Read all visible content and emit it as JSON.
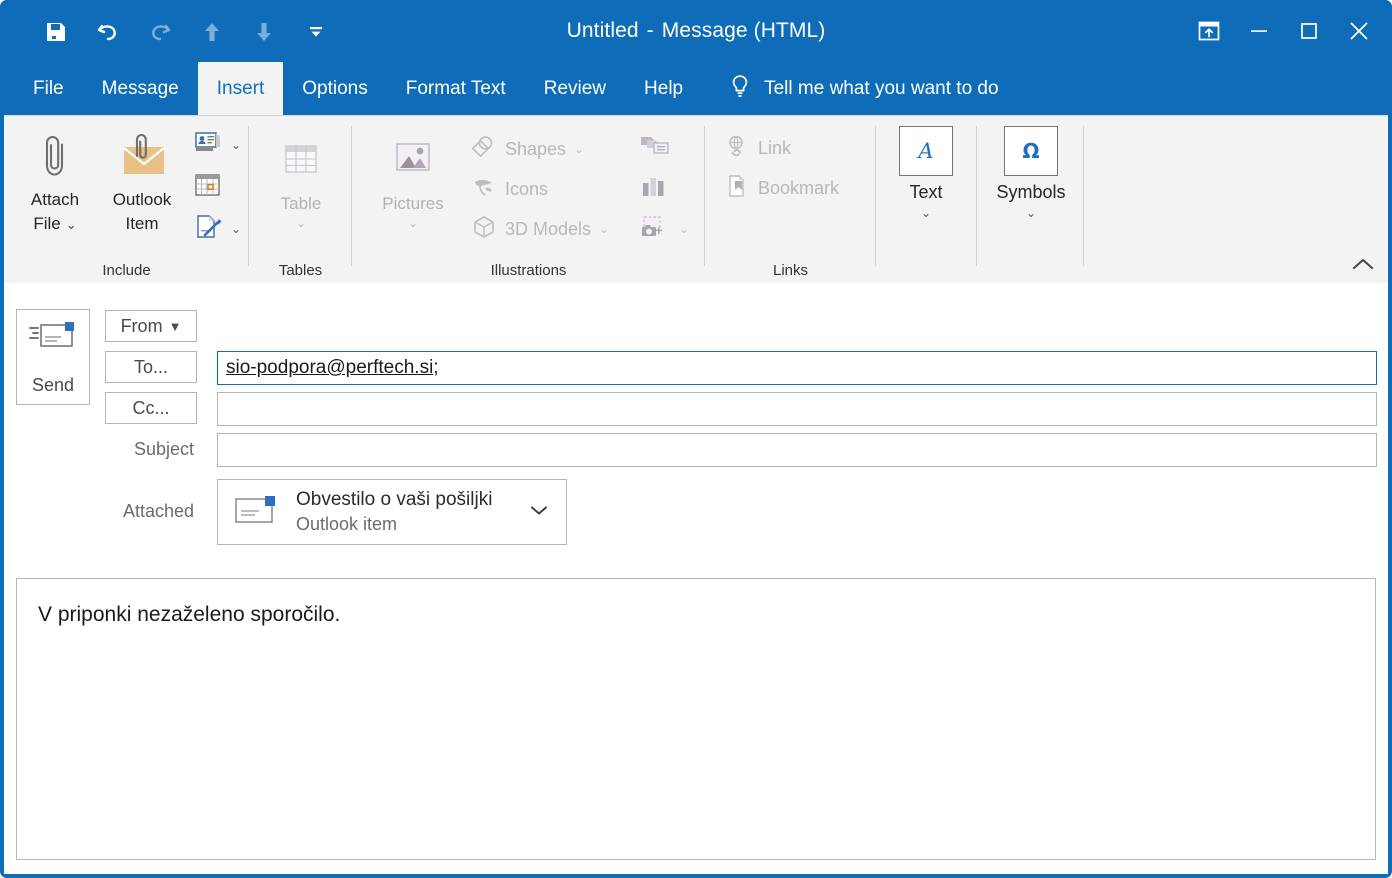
{
  "window": {
    "title_main": "Untitled",
    "title_sep": "-",
    "title_rest": "Message (HTML)",
    "accent_color": "#0f6cb8",
    "ribbon_bg": "#f3f3f3"
  },
  "quick_access": [
    {
      "name": "save-icon",
      "label": "Save",
      "enabled": true
    },
    {
      "name": "undo-icon",
      "label": "Undo",
      "enabled": true
    },
    {
      "name": "redo-icon",
      "label": "Redo",
      "enabled": false
    },
    {
      "name": "previous-item-icon",
      "label": "Previous Item",
      "enabled": false
    },
    {
      "name": "next-item-icon",
      "label": "Next Item",
      "enabled": false
    },
    {
      "name": "customize-quick-access-toolbar-icon",
      "label": "Customize Quick Access Toolbar",
      "enabled": true
    }
  ],
  "window_controls": [
    {
      "name": "ribbon-display-options-icon",
      "label": "Ribbon Display Options"
    },
    {
      "name": "minimize-icon",
      "label": "Minimize"
    },
    {
      "name": "maximize-icon",
      "label": "Maximize"
    },
    {
      "name": "close-icon",
      "label": "Close"
    }
  ],
  "tabs": [
    {
      "label": "File",
      "active": false
    },
    {
      "label": "Message",
      "active": false
    },
    {
      "label": "Insert",
      "active": true
    },
    {
      "label": "Options",
      "active": false
    },
    {
      "label": "Format Text",
      "active": false
    },
    {
      "label": "Review",
      "active": false
    },
    {
      "label": "Help",
      "active": false
    }
  ],
  "tell_me": {
    "label": "Tell me what you want to do",
    "icon": "lightbulb-icon"
  },
  "ribbon": {
    "groups": [
      {
        "name": "include",
        "label": "Include",
        "items": [
          {
            "label": "Attach\nFile",
            "label_l1": "Attach",
            "label_l2": "File",
            "enabled": true,
            "has_caret": true
          },
          {
            "label": "Outlook\nItem",
            "label_l1": "Outlook",
            "label_l2": "Item",
            "enabled": true,
            "has_caret": false
          },
          {
            "label": "Business Card",
            "enabled": true,
            "has_caret": true
          },
          {
            "label": "Calendar",
            "enabled": true,
            "has_caret": false
          },
          {
            "label": "Signature",
            "enabled": true,
            "has_caret": true
          }
        ]
      },
      {
        "name": "tables",
        "label": "Tables",
        "items": [
          {
            "label": "Table",
            "enabled": false,
            "has_caret": true
          }
        ]
      },
      {
        "name": "illustrations",
        "label": "Illustrations",
        "items": [
          {
            "label": "Pictures",
            "enabled": false,
            "has_caret": true
          },
          {
            "label": "Shapes",
            "enabled": false,
            "has_caret": true
          },
          {
            "label": "Icons",
            "enabled": false,
            "has_caret": false
          },
          {
            "label": "3D Models",
            "enabled": false,
            "has_caret": true
          },
          {
            "label": "SmartArt",
            "enabled": false,
            "has_caret": false
          },
          {
            "label": "Chart",
            "enabled": false,
            "has_caret": false
          },
          {
            "label": "Screenshot",
            "enabled": false,
            "has_caret": true
          }
        ]
      },
      {
        "name": "links",
        "label": "Links",
        "items": [
          {
            "label": "Link",
            "enabled": false,
            "has_caret": false
          },
          {
            "label": "Bookmark",
            "enabled": false,
            "has_caret": false
          }
        ]
      },
      {
        "name": "text",
        "label": "",
        "items": [
          {
            "label": "Text",
            "enabled": true,
            "has_caret": true,
            "glyph": "A"
          }
        ]
      },
      {
        "name": "symbols",
        "label": "",
        "items": [
          {
            "label": "Symbols",
            "enabled": true,
            "has_caret": true,
            "glyph": "Ω"
          }
        ]
      }
    ],
    "collapse_label": "Collapse the Ribbon",
    "collapse_icon": "chevron-up-icon"
  },
  "compose": {
    "send_button_label": "Send",
    "send_icon": "send-envelope-icon",
    "from": {
      "label": "From",
      "caret": "▼"
    },
    "to": {
      "label": "To...",
      "value": "sio-podpora@perftech.si",
      "separator": ";",
      "focused": true
    },
    "cc": {
      "label": "Cc...",
      "value": ""
    },
    "subject": {
      "label": "Subject",
      "value": ""
    },
    "attached": {
      "label": "Attached",
      "item_name": "Obvestilo o vaši pošiljki",
      "item_type": "Outlook item",
      "icon": "outlook-item-icon",
      "caret_icon": "chevron-down-icon"
    },
    "body": {
      "text": "V priponki nezaželeno sporočilo."
    }
  }
}
